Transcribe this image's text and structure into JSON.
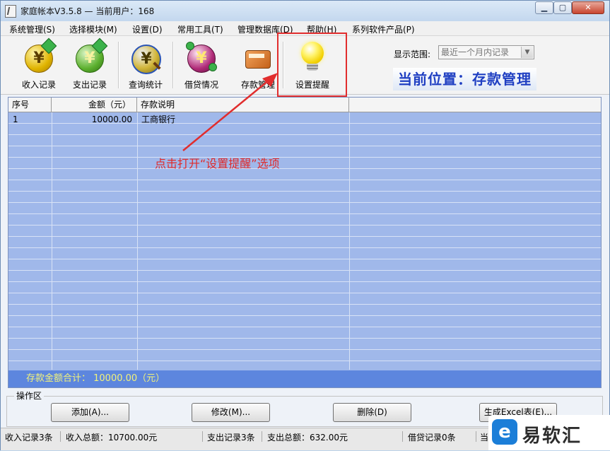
{
  "window": {
    "title": "家庭帐本V3.5.8  —  当前用户：168",
    "controls": {
      "minimize": "▁",
      "maximize": "▢",
      "close": "✕"
    }
  },
  "menu": [
    "系统管理(S)",
    "选择模块(M)",
    "设置(D)",
    "常用工具(T)",
    "管理数据库(D)",
    "帮助(H)",
    "系列软件产品(P)"
  ],
  "toolbar": {
    "tools": [
      {
        "label": "收入记录",
        "icon": "yen-coin-in-icon"
      },
      {
        "label": "支出记录",
        "icon": "yen-coin-out-icon"
      },
      {
        "label": "查询统计",
        "icon": "yen-coin-search-icon"
      },
      {
        "label": "借贷情况",
        "icon": "yen-coin-loan-icon"
      },
      {
        "label": "存款管理",
        "icon": "bank-card-icon"
      },
      {
        "label": "设置提醒",
        "icon": "light-bulb-icon"
      }
    ],
    "range_label": "显示范围:",
    "range_value": "最近一个月内记录",
    "location": "当前位置：存款管理"
  },
  "table": {
    "columns": [
      "序号",
      "金额（元）",
      "存款说明"
    ],
    "rows": [
      {
        "index": "1",
        "amount": "10000.00",
        "note": "工商银行"
      }
    ],
    "total": "存款金额合计：  10000.00（元）"
  },
  "annotation": "点击打开“设置提醒”选项",
  "ops": {
    "title": "操作区",
    "buttons": [
      "添加(A)...",
      "修改(M)...",
      "删除(D)",
      "生成Excel表(E)..."
    ]
  },
  "status": [
    "收入记录3条",
    "收入总额：10700.00元",
    "支出记录3条",
    "支出总额：632.00元",
    "借贷记录0条",
    "当"
  ],
  "watermark": {
    "logo": "e",
    "text": "易软汇"
  },
  "colors": {
    "accent_red": "#e12d2d",
    "location_text": "#1f3fc2",
    "grid_bg": "#a0b8ea",
    "total_bar": "#5d86de"
  }
}
